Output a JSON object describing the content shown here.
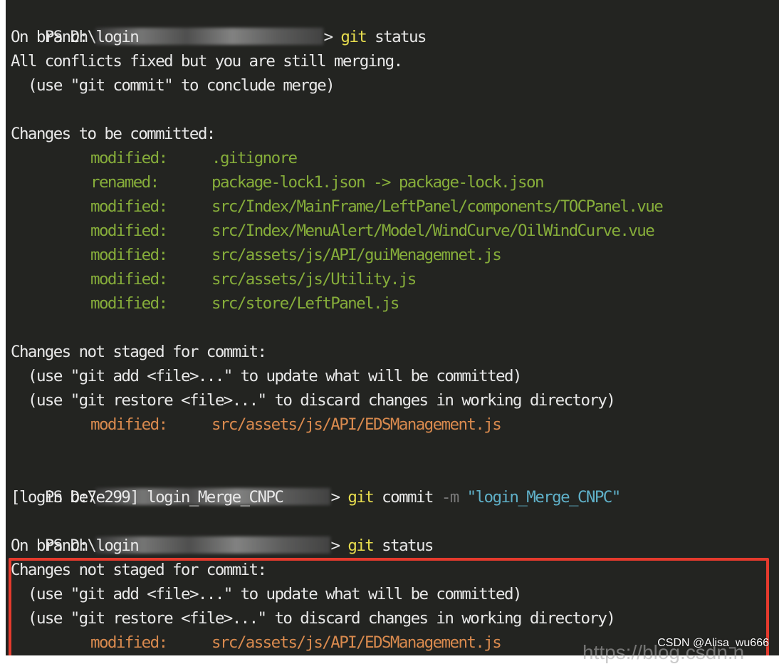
{
  "terminal": {
    "block1": {
      "prompt_prefix": "PS D:\\",
      "prompt_suffix": "> ",
      "cmd": "git",
      "args": " status",
      "branch_line": "On branch login",
      "merge_msg": "All conflicts fixed but you are still merging.",
      "merge_hint": "(use \"git commit\" to conclude merge)",
      "staged_header": "Changes to be committed:",
      "staged": [
        {
          "status": "modified:",
          "path": ".gitignore"
        },
        {
          "status": "renamed:",
          "path": "package-lock1.json -> package-lock.json"
        },
        {
          "status": "modified:",
          "path": "src/Index/MainFrame/LeftPanel/components/TOCPanel.vue"
        },
        {
          "status": "modified:",
          "path": "src/Index/MenuAlert/Model/WindCurve/OilWindCurve.vue"
        },
        {
          "status": "modified:",
          "path": "src/assets/js/API/guiMenagemnet.js"
        },
        {
          "status": "modified:",
          "path": "src/assets/js/Utility.js"
        },
        {
          "status": "modified:",
          "path": "src/store/LeftPanel.js"
        }
      ],
      "unstaged_header": "Changes not staged for commit:",
      "hint_add": "(use \"git add <file>...\" to update what will be committed)",
      "hint_restore": "(use \"git restore <file>...\" to discard changes in working directory)",
      "unstaged": [
        {
          "status": "modified:",
          "path": "src/assets/js/API/EDSManagement.js"
        }
      ]
    },
    "block2": {
      "prompt_prefix": "PS D:\\",
      "prompt_suffix": "> ",
      "cmd": "git",
      "args": " commit ",
      "flag": "-m",
      "message": " \"login_Merge_CNPC\"",
      "result": "[login be7e299] login_Merge_CNPC"
    },
    "block3": {
      "prompt_prefix": "PS D:\\",
      "prompt_suffix": "> ",
      "cmd": "git",
      "args": " status",
      "branch_line": "On branch login",
      "unstaged_header": "Changes not staged for commit:",
      "hint_add": "(use \"git add <file>...\" to update what will be committed)",
      "hint_restore": "(use \"git restore <file>...\" to discard changes in working directory)",
      "unstaged": [
        {
          "status": "modified:",
          "path": "src/assets/js/API/EDSManagement.js"
        }
      ]
    },
    "colors": {
      "background": "#232421",
      "staged": "#86ad3a",
      "unstaged": "#d98a4e",
      "command": "#e7dd4e",
      "string": "#5fb0c8",
      "highlight_box": "#e53a2d"
    }
  },
  "watermark": {
    "author": "CSDN @Alisa_wu666",
    "url_partial": "https://blog.csdn.n"
  }
}
